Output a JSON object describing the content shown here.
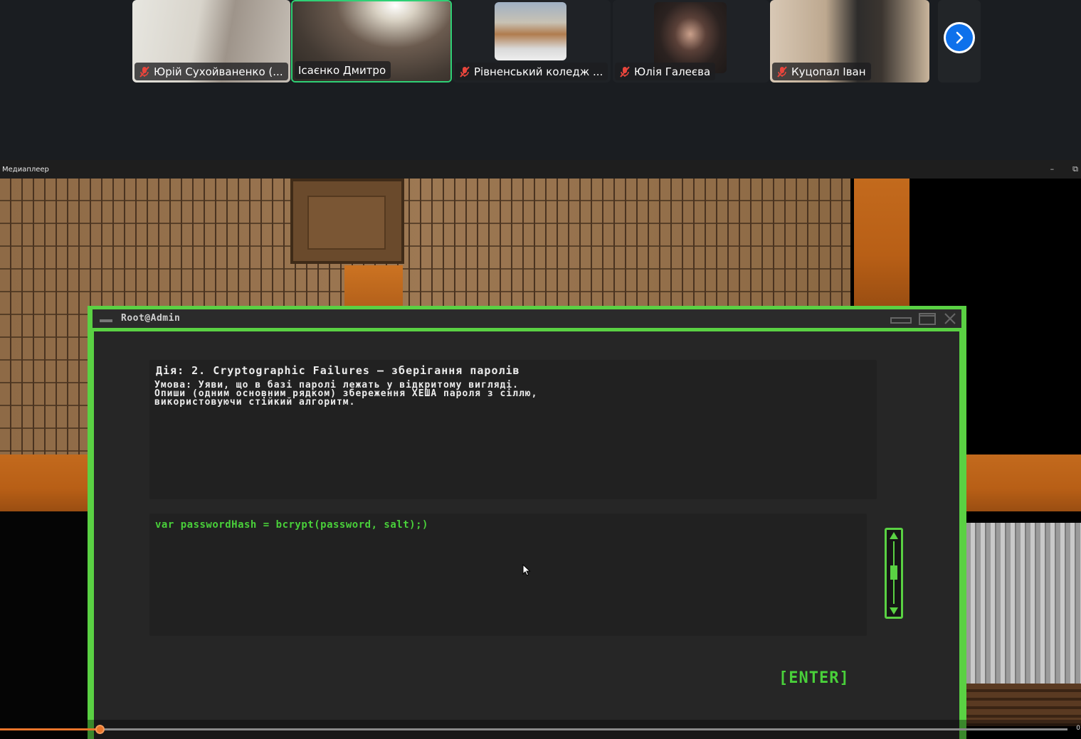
{
  "conference": {
    "participants": [
      {
        "name": "Юрій Сухойваненко (...",
        "muted": true,
        "active": false
      },
      {
        "name": "Ісаєнко Дмитро",
        "muted": false,
        "active": true
      },
      {
        "name": "Рівненський коледж ...",
        "muted": true,
        "active": false
      },
      {
        "name": "Юлія Галеєва",
        "muted": true,
        "active": false
      },
      {
        "name": "Куцопал Іван",
        "muted": true,
        "active": false
      }
    ],
    "next_icon": "chevron-right-icon"
  },
  "player": {
    "title": "Медиаплеер",
    "minimize_glyph": "–",
    "restore_glyph": "⧉",
    "seek_progress": 0.093,
    "time_label": "0"
  },
  "terminal": {
    "title": "Root@Admin",
    "task_title": "Дія: 2. Cryptographic Failures – зберігання паролів",
    "task_condition": "Умова: Уяви, що в базі паролі лежать у відкритому вигляді.\nОпиши (одним основним рядком) збереження ХЕША пароля з сіллю,\nвикористовуючи стійкий алгоритм.",
    "code_value": "var passwordHash = bcrypt(password, salt);)",
    "enter_label": "[ENTER]"
  },
  "colors": {
    "terminal_green": "#5ad143",
    "code_green": "#49d03a",
    "active_speaker": "#2fd075",
    "seek_accent": "#e8742a",
    "next_button": "#0e71eb"
  }
}
